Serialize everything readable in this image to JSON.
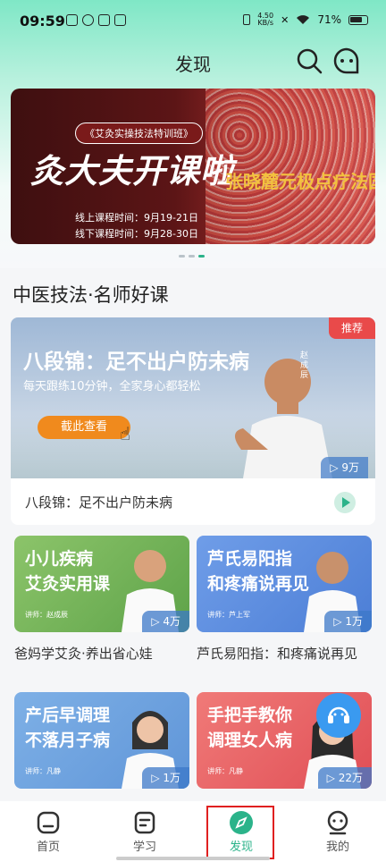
{
  "status_bar": {
    "time": "09:59",
    "net_speed_top": "4.50",
    "net_speed_unit": "KB/s",
    "battery": "71%"
  },
  "header": {
    "title": "发现",
    "search_icon": "search-icon",
    "message_icon": "chat-icon"
  },
  "banner": {
    "badge": "《艾灸实操技法特训班》",
    "headline": "灸大夫开课啦",
    "online_schedule": "线上课程时间：9月19-21日",
    "offline_schedule": "线下课程时间：9月28-30日",
    "side_text": "张晓麓元极点疗法国际培",
    "pager_count": 3,
    "pager_active": 2
  },
  "section": {
    "title": "中医技法·名师好课"
  },
  "featured": {
    "tag": "推荐",
    "title": "八段锦：足不出户防未病",
    "subtitle": "每天跟练10分钟，全家身心都轻松",
    "cta": "截此查看",
    "presenter": "赵成辰",
    "views": "▷ 9万",
    "caption": "八段锦：足不出户防未病"
  },
  "cards": [
    {
      "title_l1": "小儿疾病",
      "title_l2": "艾灸实用课",
      "teacher": "讲师：赵成辰",
      "views": "▷ 4万",
      "caption": "爸妈学艾灸·养出省心娃",
      "color1": "#8cc46a",
      "color2": "#5ea349"
    },
    {
      "title_l1": "芦氏易阳指",
      "title_l2": "和疼痛说再见",
      "teacher": "讲师：芦上军",
      "views": "▷ 1万",
      "caption": "芦氏易阳指：和疼痛说再见",
      "color1": "#6f9de8",
      "color2": "#4c7ed6"
    },
    {
      "title_l1": "产后早调理",
      "title_l2": "不落月子病",
      "teacher": "讲师：凡静",
      "views": "▷ 1万",
      "caption": "",
      "color1": "#7eb0e6",
      "color2": "#5f95d8"
    },
    {
      "title_l1": "手把手教你",
      "title_l2": "调理女人病",
      "teacher": "讲师：凡静",
      "views": "▷ 22万",
      "caption": "",
      "color1": "#f07a78",
      "color2": "#e04e55"
    }
  ],
  "tabbar": {
    "items": [
      {
        "label": "首页",
        "icon": "home-icon"
      },
      {
        "label": "学习",
        "icon": "study-icon"
      },
      {
        "label": "发现",
        "icon": "compass-icon"
      },
      {
        "label": "我的",
        "icon": "profile-icon"
      }
    ],
    "active_index": 2
  },
  "colors": {
    "accent": "#2bb38a",
    "highlight": "#e02020"
  }
}
